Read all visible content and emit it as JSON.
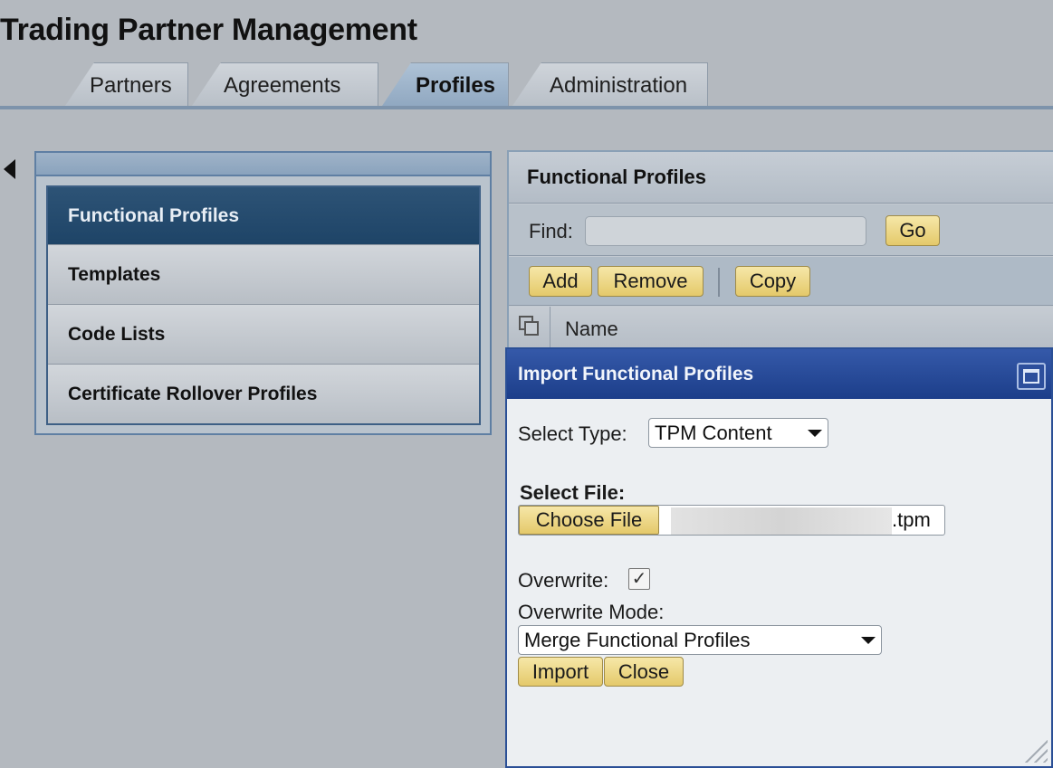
{
  "app": {
    "title": "Trading Partner Management"
  },
  "tabs": [
    {
      "label": "Partners",
      "active": false
    },
    {
      "label": "Agreements",
      "active": false
    },
    {
      "label": "Profiles",
      "active": true
    },
    {
      "label": "Administration",
      "active": false
    }
  ],
  "nav": {
    "items": [
      {
        "label": "Functional Profiles",
        "active": true
      },
      {
        "label": "Templates",
        "active": false
      },
      {
        "label": "Code Lists",
        "active": false
      },
      {
        "label": "Certificate Rollover Profiles",
        "active": false
      }
    ]
  },
  "main": {
    "title": "Functional Profiles",
    "find": {
      "label": "Find:",
      "value": "",
      "go_label": "Go"
    },
    "toolbar": {
      "add_label": "Add",
      "remove_label": "Remove",
      "copy_label": "Copy"
    },
    "table": {
      "columns": [
        "Name"
      ]
    }
  },
  "dialog": {
    "title": "Import Functional Profiles",
    "select_type": {
      "label": "Select Type:",
      "value": "TPM Content"
    },
    "select_file": {
      "label": "Select File:",
      "button_label": "Choose File",
      "file_suffix": ".tpm"
    },
    "overwrite": {
      "label": "Overwrite:",
      "checked": true,
      "check_glyph": "✓"
    },
    "overwrite_mode": {
      "label": "Overwrite Mode:",
      "value": "Merge Functional Profiles"
    },
    "import_label": "Import",
    "close_label": "Close"
  },
  "colors": {
    "accent_dark_blue": "#1e4467",
    "dialog_title_blue": "#1c3e8a",
    "button_yellow": "#e4c96a"
  }
}
